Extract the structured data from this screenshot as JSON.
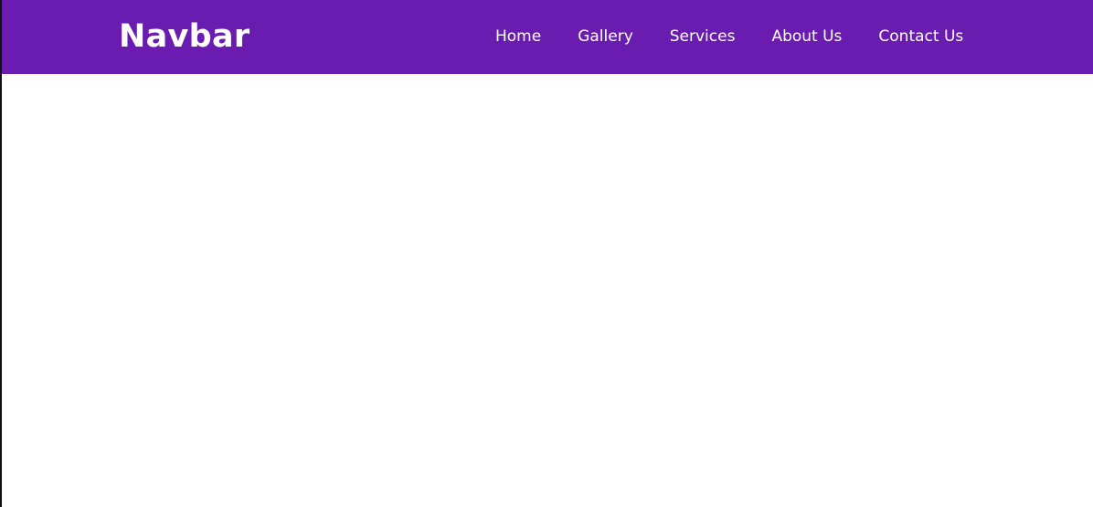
{
  "navbar": {
    "brand": "Navbar",
    "links": [
      "Home",
      "Gallery",
      "Services",
      "About Us",
      "Contact Us"
    ],
    "background_color": "#6a1bb0",
    "text_color": "#ffffff"
  }
}
